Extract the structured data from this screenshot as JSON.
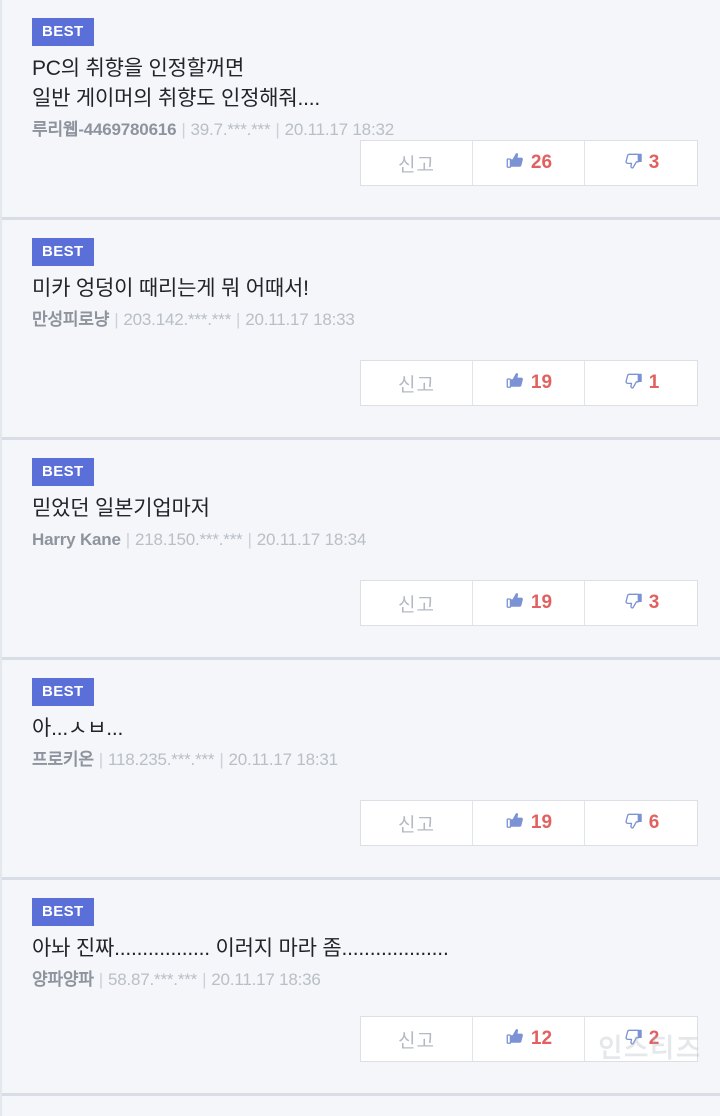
{
  "theme": {
    "page_background": "#f4f6fa",
    "badge_background": "#5b6fd8",
    "badge_text_color": "#ffffff",
    "comment_text_color": "#222429",
    "author_color": "#8e939d",
    "meta_color": "#b9bec7",
    "button_background": "#ffffff",
    "button_border": "#dcdfe6",
    "thumb_icon_color": "#7b92d4",
    "count_color": "#e2605f",
    "divider_color": "#d9dde5"
  },
  "labels": {
    "best_badge": "BEST",
    "report": "신고",
    "separator": "|",
    "like_icon": "thumbs-up-icon",
    "dislike_icon": "thumbs-down-icon"
  },
  "watermark": {
    "text": "인스티즈"
  },
  "comments": [
    {
      "badge": "BEST",
      "text": "PC의 취향을 인정할꺼면\n일반 게이머의 취향도 인정해줘....",
      "author": "루리웹-4469780616",
      "ip": "39.7.***.***",
      "time": "20.11.17 18:32",
      "report_label": "신고",
      "likes": "26",
      "dislikes": "3"
    },
    {
      "badge": "BEST",
      "text": "미카 엉덩이 때리는게 뭐 어때서!",
      "author": "만성피로냥",
      "ip": "203.142.***.***",
      "time": "20.11.17 18:33",
      "report_label": "신고",
      "likes": "19",
      "dislikes": "1"
    },
    {
      "badge": "BEST",
      "text": "믿었던 일본기업마저",
      "author": "Harry Kane",
      "ip": "218.150.***.***",
      "time": "20.11.17 18:34",
      "report_label": "신고",
      "likes": "19",
      "dislikes": "3"
    },
    {
      "badge": "BEST",
      "text": "아...ㅅㅂ...",
      "author": "프로키온",
      "ip": "118.235.***.***",
      "time": "20.11.17 18:31",
      "report_label": "신고",
      "likes": "19",
      "dislikes": "6"
    },
    {
      "badge": "BEST",
      "text": "아놔 진짜................. 이러지 마라 좀...................",
      "author": "양파양파",
      "ip": "58.87.***.***",
      "time": "20.11.17 18:36",
      "report_label": "신고",
      "likes": "12",
      "dislikes": "2"
    }
  ]
}
